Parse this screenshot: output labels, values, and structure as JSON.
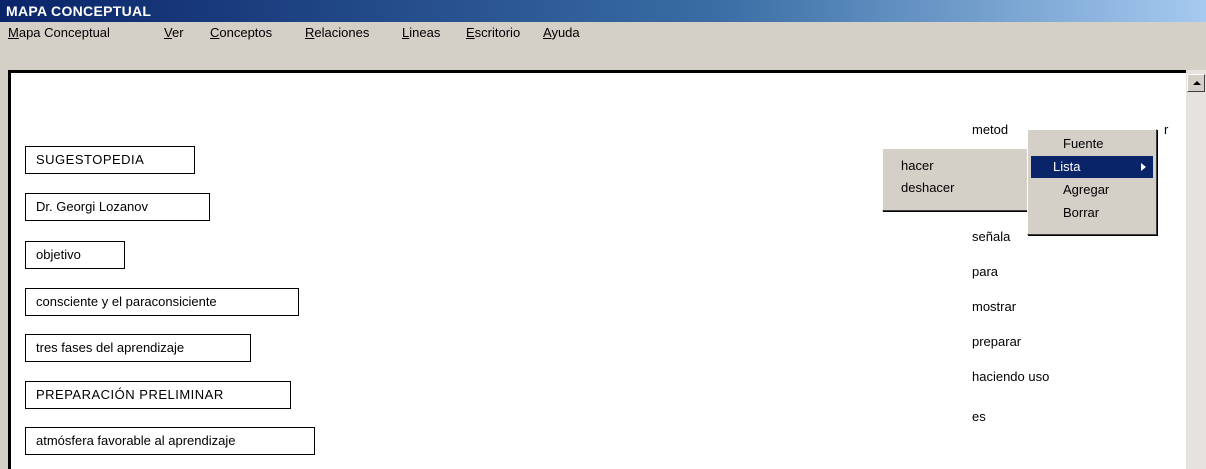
{
  "window": {
    "title": "MAPA CONCEPTUAL"
  },
  "menubar": {
    "items": [
      "Mapa Conceptual",
      "Ver",
      "Conceptos",
      "Relaciones",
      "Lineas",
      "Escritorio",
      "Ayuda"
    ]
  },
  "concepts": [
    "SUGESTOPEDIA",
    "Dr. Georgi Lozanov",
    "objetivo",
    "consciente y el paraconsiciente",
    "tres fases del aprendizaje",
    "PREPARACIÓN PRELIMINAR",
    "atmósfera favorable al aprendizaje"
  ],
  "relations": {
    "partial": "metod",
    "partial_end": "r",
    "items": [
      "señala",
      "para",
      "mostrar",
      "preparar",
      "haciendo uso",
      "es"
    ]
  },
  "undo_menu": {
    "items": [
      "hacer",
      "deshacer"
    ]
  },
  "context_menu": {
    "items": [
      "Fuente",
      "Lista",
      "Agregar",
      "Borrar"
    ]
  },
  "colors": {
    "selection": "#0a246a",
    "chrome": "#d4d0c8"
  }
}
